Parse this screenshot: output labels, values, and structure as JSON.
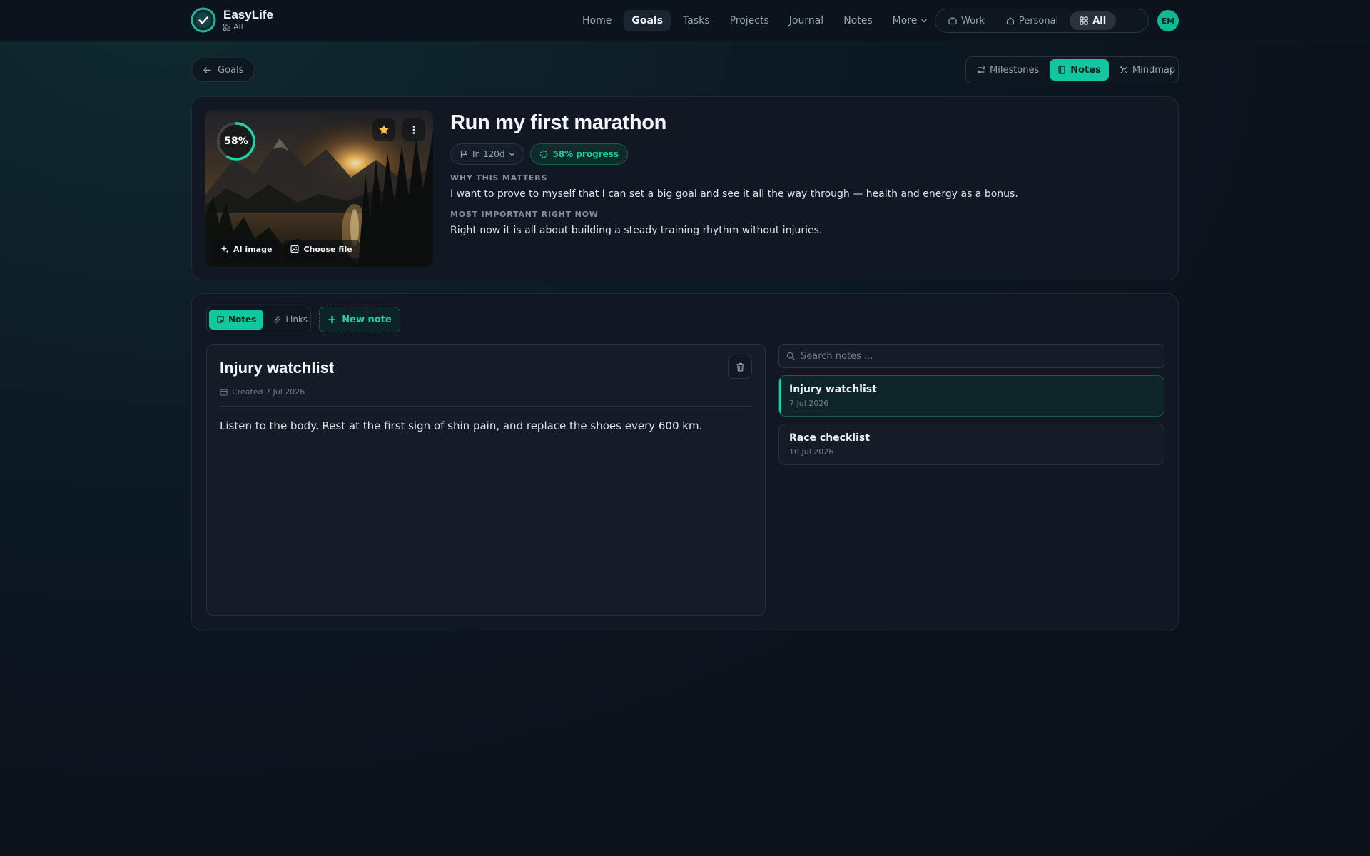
{
  "app": {
    "name": "EasyLife",
    "scope": "All"
  },
  "nav": {
    "items": [
      {
        "label": "Home",
        "active": false
      },
      {
        "label": "Goals",
        "active": true
      },
      {
        "label": "Tasks",
        "active": false
      },
      {
        "label": "Projects",
        "active": false
      },
      {
        "label": "Journal",
        "active": false
      },
      {
        "label": "Notes",
        "active": false
      },
      {
        "label": "More",
        "active": false
      }
    ]
  },
  "scope_switch": {
    "work": "Work",
    "personal": "Personal",
    "all": "All",
    "selected": "All"
  },
  "user": {
    "initials": "EM"
  },
  "back": {
    "label": "Goals"
  },
  "views": {
    "milestones": "Milestones",
    "notes": "Notes",
    "mindmap": "Mindmap",
    "selected": "Notes"
  },
  "goal": {
    "title": "Run my first marathon",
    "progress": 58,
    "progress_label": "58%",
    "deadline_chip": "In 120d",
    "progress_chip": "58% progress",
    "favorite": true,
    "ai_image_label": "AI image",
    "choose_file_label": "Choose file",
    "why_label": "WHY THIS MATTERS",
    "why_text": "I want to prove to myself that I can set a big goal and see it all the way through — health and energy as a bonus.",
    "focus_label": "MOST IMPORTANT RIGHT NOW",
    "focus_text": "Right now it is all about building a steady training rhythm without injuries."
  },
  "notes_panel": {
    "tabs": {
      "notes": "Notes",
      "links": "Links",
      "selected": "Notes"
    },
    "new_note_label": "New note",
    "search_placeholder": "Search notes ...",
    "search_value": "",
    "editor": {
      "title": "Injury watchlist",
      "created": "Created 7 Jul 2026",
      "body": "Listen to the body. Rest at the first sign of shin pain, and replace the shoes every 600 km."
    },
    "list": [
      {
        "title": "Injury watchlist",
        "date": "7 Jul 2026",
        "selected": true
      },
      {
        "title": "Race checklist",
        "date": "10 Jul 2026",
        "selected": false
      }
    ]
  },
  "colors": {
    "accent": "#10c7a0",
    "accent_text": "#19d3a9",
    "background": "#0b121c",
    "card": "#111823",
    "star": "#f5c542"
  },
  "icons": {
    "logo": "check-circle-icon",
    "back": "arrow-left-icon",
    "search": "search-icon",
    "delete": "trash-icon",
    "calendar": "calendar-icon"
  }
}
